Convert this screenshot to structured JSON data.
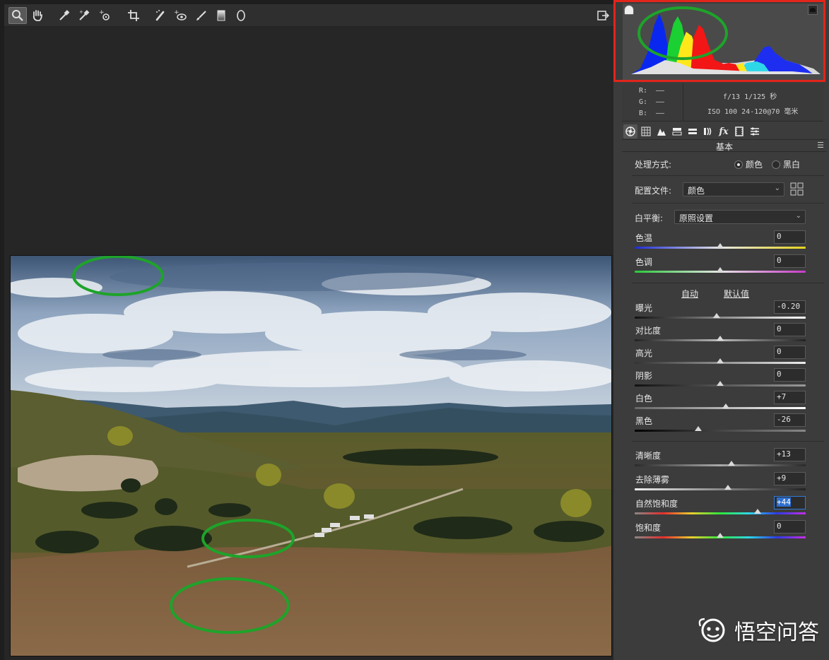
{
  "toolbar": {
    "tools": [
      {
        "name": "zoom-tool-icon",
        "glyph": "🔍",
        "active": true
      },
      {
        "name": "hand-tool-icon",
        "glyph": "✋"
      },
      {
        "name": "white-balance-tool-icon",
        "glyph": "✒"
      },
      {
        "name": "color-sampler-tool-icon",
        "glyph": "✒"
      },
      {
        "name": "targeted-adjustment-tool-icon",
        "glyph": "⊕"
      },
      {
        "name": "crop-tool-icon",
        "glyph": "⌗"
      },
      {
        "name": "spot-removal-tool-icon",
        "glyph": "✎"
      },
      {
        "name": "red-eye-tool-icon",
        "glyph": "👁"
      },
      {
        "name": "adjustment-brush-icon",
        "glyph": "🖌"
      },
      {
        "name": "graduated-filter-icon",
        "glyph": "▥"
      },
      {
        "name": "radial-filter-icon",
        "glyph": "◯"
      }
    ],
    "open_preferences_icon": "export-icon"
  },
  "readout": {
    "r_label": "R:",
    "r_value": "——",
    "g_label": "G:",
    "g_value": "——",
    "b_label": "B:",
    "b_value": "——",
    "camera_line1": "f/13  1/125 秒",
    "camera_line2": "ISO 100  24-120@70 毫米"
  },
  "panel": {
    "tabs": [
      "basic-icon",
      "tone-curve-icon",
      "detail-icon",
      "hsl-icon",
      "split-toning-icon",
      "lens-corrections-icon",
      "effects-icon",
      "camera-calibration-icon",
      "presets-icon"
    ],
    "section_title": "基本",
    "treatment_label": "处理方式:",
    "treatment_color": "颜色",
    "treatment_bw": "黑白",
    "profile_label": "配置文件:",
    "profile_value": "颜色",
    "wb_label": "白平衡:",
    "wb_value": "原照设置",
    "auto_label": "自动",
    "default_label": "默认值"
  },
  "sliders": {
    "temp": {
      "label": "色温",
      "value": "0",
      "level": 0.5
    },
    "tint": {
      "label": "色调",
      "value": "0",
      "level": 0.5
    },
    "exposure": {
      "label": "曝光",
      "value": "-0.20",
      "level": 0.48
    },
    "contrast": {
      "label": "对比度",
      "value": "0",
      "level": 0.5
    },
    "highlights": {
      "label": "高光",
      "value": "0",
      "level": 0.5
    },
    "shadows": {
      "label": "阴影",
      "value": "0",
      "level": 0.5
    },
    "whites": {
      "label": "白色",
      "value": "+7",
      "level": 0.535
    },
    "blacks": {
      "label": "黑色",
      "value": "-26",
      "level": 0.37
    },
    "clarity": {
      "label": "清晰度",
      "value": "+13",
      "level": 0.565
    },
    "dehaze": {
      "label": "去除薄雾",
      "value": "+9",
      "level": 0.545
    },
    "vibrance": {
      "label": "自然饱和度",
      "value": "+44",
      "level": 0.72
    },
    "saturation": {
      "label": "饱和度",
      "value": "0",
      "level": 0.5
    }
  },
  "watermark": {
    "text": "悟空问答"
  },
  "colors": {
    "highlight_border": "#e1251b",
    "annotation_ellipse": "#1ea32a",
    "focus_border": "#2f7ad8"
  }
}
